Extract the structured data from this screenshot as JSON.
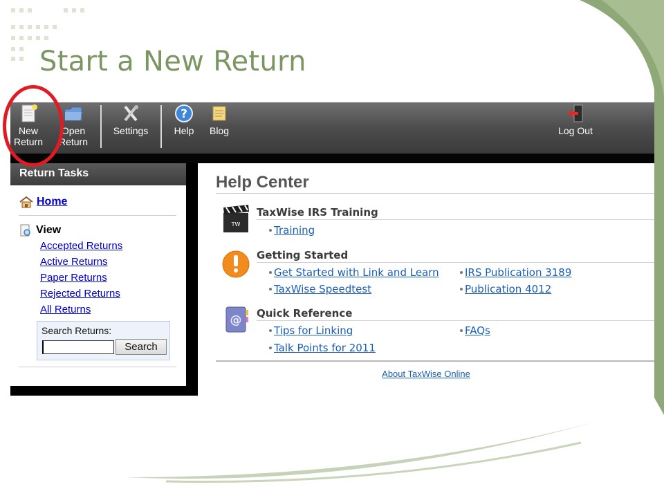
{
  "slide": {
    "title": "Start a New Return"
  },
  "toolbar": {
    "new_return": [
      "New",
      "Return"
    ],
    "open_return": [
      "Open",
      "Return"
    ],
    "settings": "Settings",
    "help": "Help",
    "blog": "Blog",
    "logout": "Log Out"
  },
  "sidebar": {
    "header": "Return Tasks",
    "home": "Home",
    "view": "View",
    "view_links": [
      "Accepted Returns",
      "Active Returns",
      "Paper Returns",
      "Rejected Returns",
      "All Returns"
    ],
    "search_label": "Search Returns:",
    "search_value": "",
    "search_button": "Search"
  },
  "help_center": {
    "title": "Help Center",
    "sections": [
      {
        "heading": "TaxWise IRS Training",
        "icon": "clapperboard-icon",
        "links": [
          "Training"
        ]
      },
      {
        "heading": "Getting Started",
        "icon": "exclamation-icon",
        "links": [
          "Get Started with Link and Learn",
          "TaxWise Speedtest",
          "IRS Publication 3189",
          "Publication 4012"
        ]
      },
      {
        "heading": "Quick Reference",
        "icon": "address-book-icon",
        "links": [
          "Tips for Linking",
          "Talk Points for 2011",
          "FAQs"
        ]
      }
    ],
    "about": "About TaxWise Online"
  },
  "colors": {
    "title_green": "#7b9660",
    "toolbar": "#4f4f4f",
    "highlight_red": "#e11b22",
    "link_blue": "#1a5fb4"
  }
}
